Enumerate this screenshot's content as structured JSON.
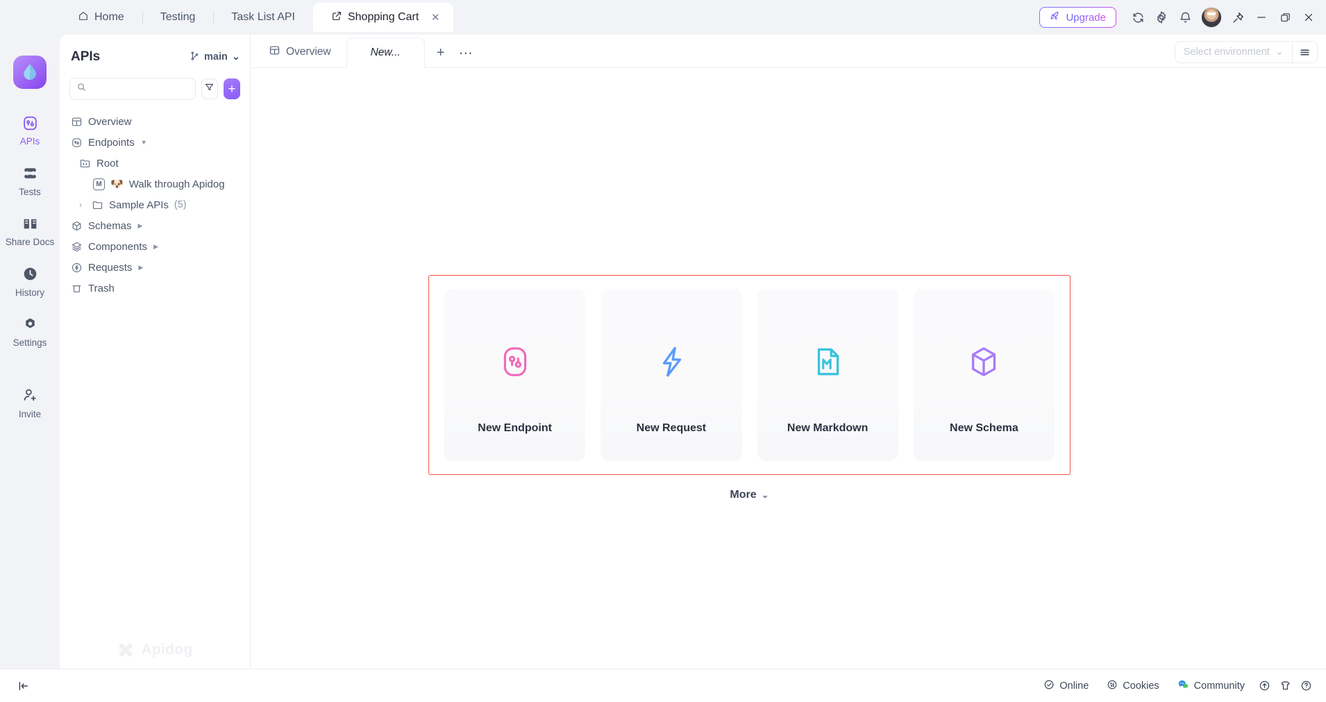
{
  "window": {
    "tabs": [
      {
        "label": "Home",
        "icon": "home-icon",
        "active": false
      },
      {
        "label": "Testing",
        "icon": "",
        "active": false
      },
      {
        "label": "Task List API",
        "icon": "",
        "active": false
      },
      {
        "label": "Shopping Cart",
        "icon": "external-link-icon",
        "active": true,
        "close": "✕"
      }
    ],
    "upgrade_label": "Upgrade",
    "upgrade_icon": "rocket-icon",
    "controls": [
      {
        "name": "sync-icon"
      },
      {
        "name": "gear-icon"
      },
      {
        "name": "bell-icon"
      },
      {
        "name": "avatar"
      },
      {
        "name": "pin-icon"
      },
      {
        "name": "minimize-icon"
      },
      {
        "name": "maximize-icon"
      },
      {
        "name": "close-icon"
      }
    ]
  },
  "rail": {
    "logo": "apidog-droplet-logo",
    "items": [
      {
        "label": "APIs",
        "icon": "api-endpoint-icon",
        "active": true
      },
      {
        "label": "Tests",
        "icon": "test-stack-icon",
        "active": false
      },
      {
        "label": "Share Docs",
        "icon": "book-icon",
        "active": false
      },
      {
        "label": "History",
        "icon": "clock-icon",
        "active": false
      },
      {
        "label": "Settings",
        "icon": "gear-filled-icon",
        "active": false
      },
      {
        "label": "Invite",
        "icon": "user-plus-icon",
        "active": false
      }
    ]
  },
  "sidebar": {
    "title": "APIs",
    "branch": {
      "label": "main",
      "icon": "git-branch-icon",
      "chevron": "⌄"
    },
    "search": {
      "value": "",
      "placeholder": "",
      "icon": "search-icon"
    },
    "filter_icon": "funnel-icon",
    "add_label": "+",
    "watermark": "Apidog",
    "tree": [
      {
        "label": "Overview",
        "icon": "overview-icon",
        "level": 0,
        "caret": false,
        "chevron": ""
      },
      {
        "label": "Endpoints",
        "icon": "api-endpoint-icon",
        "level": 0,
        "caret": true,
        "chevron": ""
      },
      {
        "label": "Root",
        "icon": "folder-code-icon",
        "level": 1,
        "caret": false,
        "chevron": ""
      },
      {
        "label": "Walk through Apidog",
        "icon": "markdown-badge",
        "emoji": "🐶",
        "level": 2,
        "caret": false,
        "chevron": ""
      },
      {
        "label": "Sample APIs",
        "count": "(5)",
        "icon": "folder-icon",
        "level": 1,
        "caret": false,
        "chevron": "›"
      },
      {
        "label": "Schemas",
        "icon": "schema-box-icon",
        "level": 0,
        "caret": true,
        "chevron": ""
      },
      {
        "label": "Components",
        "icon": "layers-icon",
        "level": 0,
        "caret": true,
        "chevron": ""
      },
      {
        "label": "Requests",
        "icon": "request-bolt-icon",
        "level": 0,
        "caret": true,
        "chevron": ""
      },
      {
        "label": "Trash",
        "icon": "trash-icon",
        "level": 0,
        "caret": false,
        "chevron": ""
      }
    ]
  },
  "main": {
    "tabs": [
      {
        "label": "Overview",
        "icon": "overview-icon",
        "active": false
      },
      {
        "label": "New...",
        "icon": "",
        "active": true
      }
    ],
    "add_tab_label": "+",
    "more_tabs_label": "⋯",
    "environment": {
      "placeholder": "Select environment",
      "chevron": "⌄",
      "menu_icon": "hamburger-icon"
    },
    "cards": [
      {
        "label": "New Endpoint",
        "icon": "endpoint-pink-icon",
        "color": "#f368b8"
      },
      {
        "label": "New Request",
        "icon": "bolt-blue-icon",
        "color": "#5b9bf8"
      },
      {
        "label": "New Markdown",
        "icon": "markdown-cyan-icon",
        "color": "#3cc3dd"
      },
      {
        "label": "New Schema",
        "icon": "schema-purple-icon",
        "color": "#a77df4"
      }
    ],
    "more": {
      "label": "More",
      "chevron": "⌄"
    },
    "highlight_color": "#f0554a"
  },
  "statusbar": {
    "collapse_icon": "collapse-panel-icon",
    "items": [
      {
        "label": "Online",
        "icon": "check-circle-icon"
      },
      {
        "label": "Cookies",
        "icon": "cookie-icon"
      },
      {
        "label": "Community",
        "icon": "chat-bubble-icon"
      }
    ],
    "icons": [
      {
        "name": "upload-circle-icon"
      },
      {
        "name": "tshirt-icon"
      },
      {
        "name": "help-circle-icon"
      }
    ]
  }
}
